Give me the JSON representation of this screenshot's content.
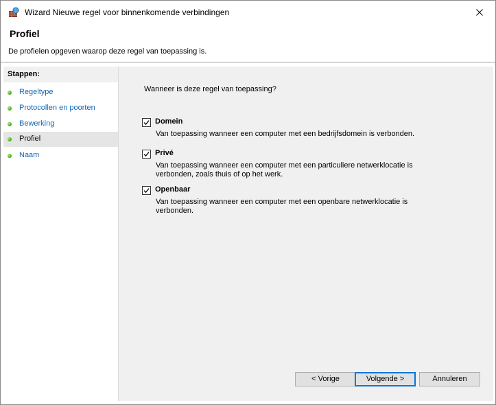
{
  "window": {
    "title": "Wizard Nieuwe regel voor binnenkomende verbindingen"
  },
  "header": {
    "title": "Profiel",
    "description": "De profielen opgeven waarop deze regel van toepassing is."
  },
  "steps": {
    "heading": "Stappen:",
    "items": [
      {
        "label": "Regeltype",
        "current": false
      },
      {
        "label": "Protocollen en poorten",
        "current": false
      },
      {
        "label": "Bewerking",
        "current": false
      },
      {
        "label": "Profiel",
        "current": true
      },
      {
        "label": "Naam",
        "current": false
      }
    ]
  },
  "content": {
    "question": "Wanneer is deze regel van toepassing?",
    "options": [
      {
        "label": "Domein",
        "checked": true,
        "description": "Van toepassing wanneer een computer met een bedrijfsdomein is verbonden."
      },
      {
        "label": "Privé",
        "checked": true,
        "description": "Van toepassing wanneer een computer met een particuliere netwerklocatie is verbonden, zoals thuis of op het werk."
      },
      {
        "label": "Openbaar",
        "checked": true,
        "description": "Van toepassing wanneer een computer met een openbare netwerklocatie is verbonden."
      }
    ]
  },
  "buttons": {
    "back": "< Vorige",
    "next": "Volgende >",
    "cancel": "Annuleren"
  },
  "icons": {
    "app": "firewall-icon",
    "close": "close-icon",
    "step_status": "green-dot-icon",
    "check": "check-icon"
  },
  "colors": {
    "link": "#1466b8",
    "accent": "#0078d7",
    "step_dot": "#4cb81c"
  }
}
